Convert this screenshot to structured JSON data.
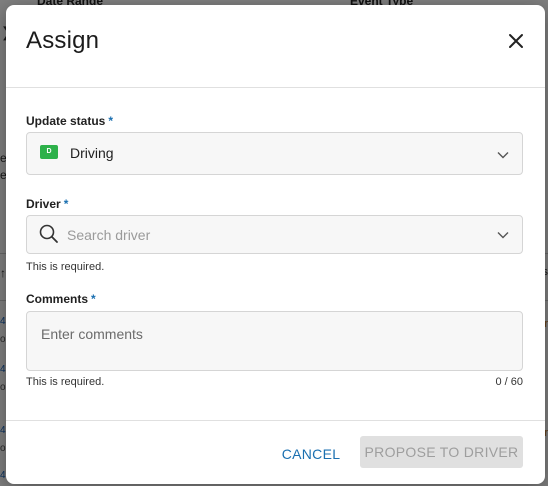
{
  "background": {
    "date_range_label": "Date Range",
    "event_type_label": "Event Type"
  },
  "modal": {
    "title": "Assign",
    "status_field": {
      "label": "Update status",
      "required_mark": "*",
      "badge_letter": "D",
      "badge_color": "#2db14a",
      "value": "Driving"
    },
    "driver_field": {
      "label": "Driver",
      "required_mark": "*",
      "placeholder": "Search driver",
      "helper": "This is required."
    },
    "comments_field": {
      "label": "Comments",
      "required_mark": "*",
      "placeholder": "Enter comments",
      "helper": "This is required.",
      "counter": "0 / 60"
    },
    "footer": {
      "cancel_label": "CANCEL",
      "propose_label": "PROPOSE TO DRIVER"
    }
  },
  "colors": {
    "accent": "#1a6fb0",
    "disabled_bg": "#e0e0e0",
    "disabled_text": "#9e9e9e"
  }
}
